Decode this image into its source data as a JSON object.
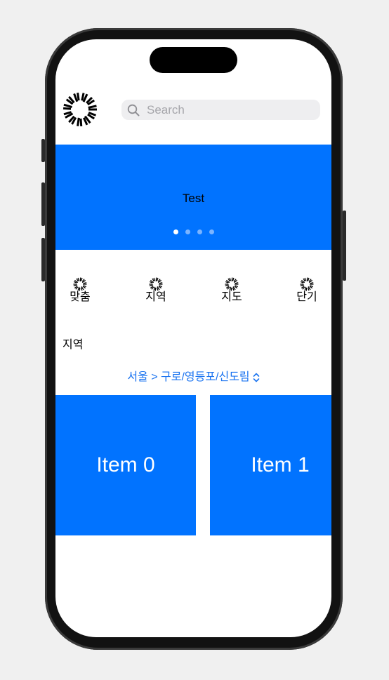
{
  "search": {
    "placeholder": "Search"
  },
  "banner": {
    "text": "Test",
    "page_count": 4,
    "active_page": 1
  },
  "categories": [
    {
      "label": "맞춤",
      "icon": "loading-spinner-icon"
    },
    {
      "label": "지역",
      "icon": "loading-spinner-icon"
    },
    {
      "label": "지도",
      "icon": "loading-spinner-icon"
    },
    {
      "label": "단기",
      "icon": "loading-spinner-icon"
    }
  ],
  "section": {
    "title": "지역",
    "region_selector": "서울 > 구로/영등포/신도림"
  },
  "items": [
    {
      "label": "Item 0"
    },
    {
      "label": "Item 1"
    }
  ],
  "colors": {
    "accent": "#0173ff",
    "link": "#1a73f0",
    "search_bg": "#eeeef0"
  }
}
